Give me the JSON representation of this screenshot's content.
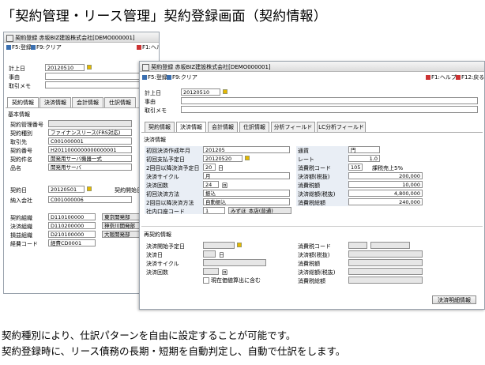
{
  "page_title": "「契約管理・リース管理」契約登録画面（契約情報）",
  "captions": [
    "契約種別により、仕訳パターンを自由に設定することが可能です。",
    "契約登録時に、リース債務の長期・短期を自動判定し、自動で仕訳をします。"
  ],
  "back_window": {
    "title": "契約登録 赤坂BIZ建設株式会社[DEMO000001]",
    "toolbar": {
      "f5": "F5:登録",
      "f9": "F9:クリア",
      "f1": "F1:ヘルプ"
    },
    "keijo_label": "計上日",
    "keijo_value": "20120510",
    "jiyu_label": "事由",
    "torihiki_label": "取引メモ",
    "tabs": [
      "契約情報",
      "決済情報",
      "会計情報",
      "仕訳情報"
    ],
    "section": "基本情報",
    "fields": [
      {
        "label": "契約管理番号",
        "value": ""
      },
      {
        "label": "契約種別",
        "value": "ファイナンスリース(FRS対応)"
      },
      {
        "label": "取引先",
        "value": "C001000001"
      },
      {
        "label": "契約番号",
        "value": "H2011000000000000001"
      },
      {
        "label": "契約件名",
        "value": "開発用サーバ機器一式"
      },
      {
        "label": "品名",
        "value": "開発用サーバ"
      }
    ],
    "keiyakubi_label": "契約日",
    "keiyakubi_value": "20120501",
    "kaishi_label": "契約開始日",
    "nyusha_label": "納入会社",
    "nyusha_value": "C001000006",
    "bottom": [
      {
        "label": "契約組織",
        "value": "D110100000",
        "name": "東京開発部"
      },
      {
        "label": "決済組織",
        "value": "D110200000",
        "name": "神奈川開発部"
      },
      {
        "label": "損益組織",
        "value": "D210100000",
        "name": "大阪開発部"
      },
      {
        "label": "経費コード",
        "value": "経費CD0001",
        "name": ""
      }
    ]
  },
  "front_window": {
    "title": "契約登録 赤坂BIZ建設株式会社[DEMO000001]",
    "toolbar": {
      "f5": "F5:登録",
      "f9": "F9:クリア",
      "f1": "F1:ヘルプ",
      "f12": "F12:戻る"
    },
    "keijo_label": "計上日",
    "keijo_value": "20120510",
    "jiyu_label": "事由",
    "torihiki_label": "取引メモ",
    "tabs": [
      "契約情報",
      "決済情報",
      "会計情報",
      "仕訳情報",
      "分析フィールド",
      "LC分析フィールド"
    ],
    "section1": "決済情報",
    "left": [
      {
        "label": "初回決済作成年月",
        "value": "201205"
      },
      {
        "label": "初回支払予定日",
        "value": "20120520"
      },
      {
        "label": "2回目以降決済予定日",
        "value": "20",
        "suffix": "日"
      },
      {
        "label": "決済サイクル",
        "value": "月"
      },
      {
        "label": "決済回数",
        "value": "24",
        "suffix": "回"
      },
      {
        "label": "初回決済方法",
        "value": "振込"
      },
      {
        "label": "2回目以降決済方法",
        "value": "自動振込"
      },
      {
        "label": "社内口座コード",
        "value": "1",
        "extra": "みずほ_本店(普通)"
      }
    ],
    "right": [
      {
        "label": "通貨",
        "value": "円"
      },
      {
        "label": "レート",
        "value": "1.0"
      },
      {
        "label": "消費税コード",
        "value": "105",
        "extra": "課税売上5%"
      },
      {
        "label": "決済額(税抜)",
        "value": "200,000"
      },
      {
        "label": "消費税額",
        "value": "10,000"
      },
      {
        "label": "決済総額(税抜)",
        "value": "4,800,000"
      },
      {
        "label": "消費税総額",
        "value": "240,000"
      }
    ],
    "section2": "再契約情報",
    "left2": [
      {
        "label": "決済開始予定日",
        "value": ""
      },
      {
        "label": "決済日",
        "value": "",
        "suffix": "日"
      },
      {
        "label": "決済サイクル",
        "value": ""
      },
      {
        "label": "決済回数",
        "value": "",
        "suffix": "回"
      }
    ],
    "checkbox_label": "現在価値算出に含む",
    "right2": [
      {
        "label": "消費税コード",
        "value": ""
      },
      {
        "label": "決済額(税抜)",
        "value": ""
      },
      {
        "label": "消費税額",
        "value": ""
      },
      {
        "label": "決済総額(税抜)",
        "value": ""
      },
      {
        "label": "消費税総額",
        "value": ""
      }
    ],
    "detail_button": "決済明細情報"
  }
}
